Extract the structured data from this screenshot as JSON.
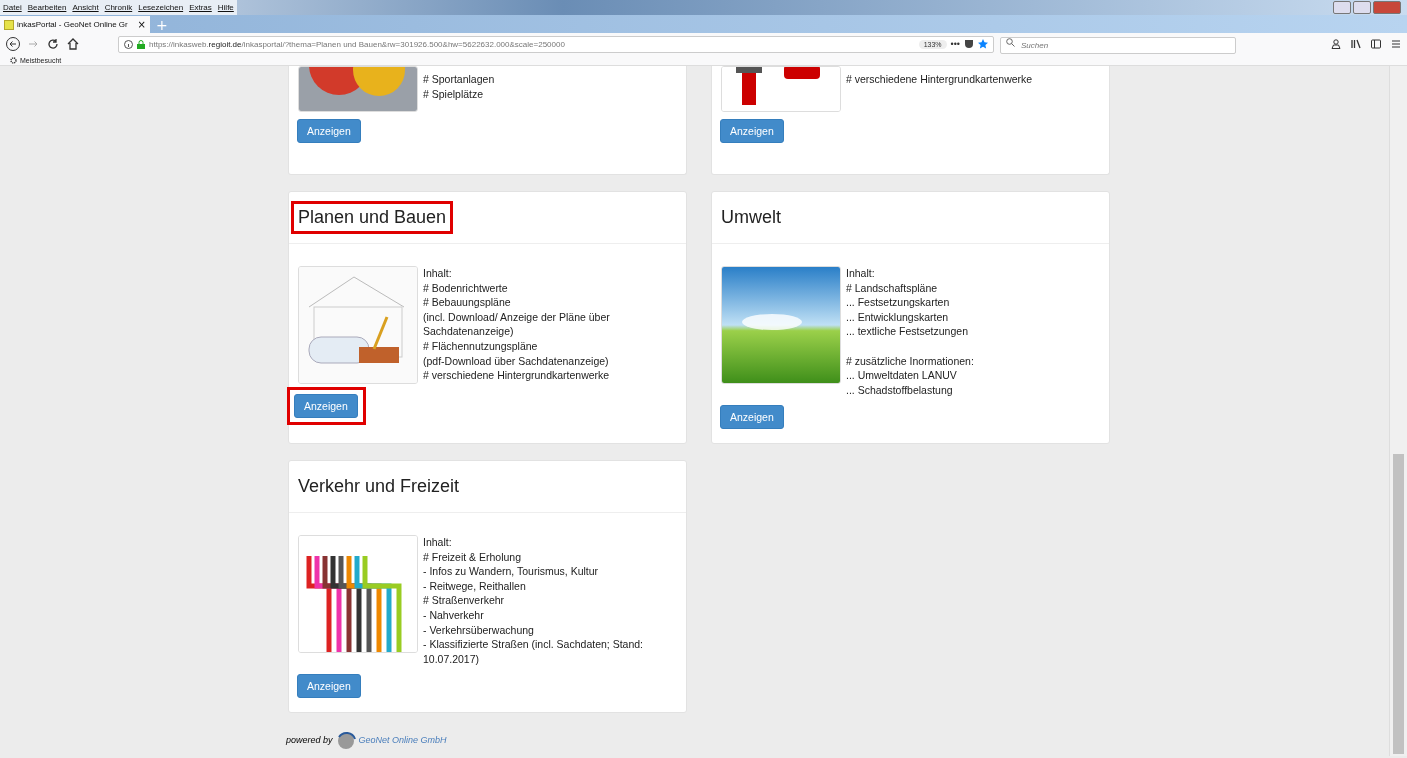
{
  "browser": {
    "menu": [
      "Datei",
      "Bearbeiten",
      "Ansicht",
      "Chronik",
      "Lesezeichen",
      "Extras",
      "Hilfe"
    ],
    "tab": {
      "title": "inkasPortal - GeoNet Online Gr",
      "selected": true,
      "close": "×"
    },
    "new_tab": "+",
    "more": "•••",
    "url": {
      "prefix": "https://inkasweb.",
      "domain": "regioit.de",
      "path": "/inkasportal/?thema=Planen und Bauen&rw=301926.500&hw=5622632.000&scale=250000"
    },
    "zoom": "133%",
    "search": {
      "placeholder": "Suchen"
    },
    "bookmarks": [
      "Meistbesucht"
    ]
  },
  "cards": [
    {
      "paragraphs": [
        [
          "# Sportanlagen",
          "# Spielplätze"
        ]
      ],
      "button": "Anzeigen",
      "highlighted_button": false
    },
    {
      "paragraphs": [
        [
          "# verschiedene Hintergrundkartenwerke"
        ]
      ],
      "button": "Anzeigen",
      "highlighted_button": false
    },
    {
      "title": "Planen und Bauen",
      "highlighted_title": true,
      "paragraphs": [
        [
          "Inhalt:",
          "# Bodenrichtwerte",
          "# Bebauungspläne",
          "(incl. Download/ Anzeige der Pläne über Sachdatenanzeige)",
          "# Flächennutzungspläne",
          "(pdf-Download über Sachdatenanzeige)",
          "# verschiedene Hintergrundkartenwerke"
        ]
      ],
      "button": "Anzeigen",
      "highlighted_button": true
    },
    {
      "title": "Umwelt",
      "highlighted_title": false,
      "paragraphs": [
        [
          "Inhalt:",
          "# Landschaftspläne",
          "... Festsetzungskarten",
          "... Entwicklungskarten",
          "... textliche Festsetzungen"
        ],
        [
          "# zusätzliche Inormationen:",
          "... Umweltdaten LANUV",
          "... Schadstoffbelastung"
        ]
      ],
      "button": "Anzeigen",
      "highlighted_button": false
    },
    {
      "title": "Verkehr und Freizeit",
      "highlighted_title": false,
      "paragraphs": [
        [
          "Inhalt:",
          "# Freizeit & Erholung",
          "- Infos zu Wandern, Tourismus, Kultur",
          "- Reitwege, Reithallen",
          "# Straßenverkehr",
          "- Nahverkehr",
          "- Verkehrsüberwachung",
          "- Klassifizierte Straßen (incl. Sachdaten; Stand: 10.07.2017)"
        ]
      ],
      "button": "Anzeigen",
      "highlighted_button": false
    }
  ],
  "footer": {
    "prefix": "powered by",
    "company": "GeoNet Online GmbH"
  }
}
